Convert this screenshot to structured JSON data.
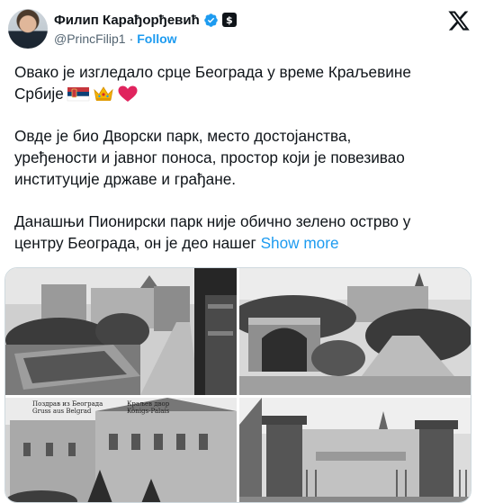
{
  "author": {
    "display_name": "Филип Карађорђевић",
    "handle": "@PrincFilip1",
    "separator": "·",
    "follow_label": "Follow",
    "badge_label": "$"
  },
  "tweet": {
    "line1": "Овако је изгледало срце Београда у време Краљевине",
    "line2": "Србије",
    "para2": "Овде је био Дворски парк, место достојанства, уређености и јавног поноса, простор који је повезивао институције државе и грађане.",
    "para3": "Данашњи Пионирски парк није обично зелено острво у центру Београда, он је део нашег",
    "show_more": "Show more"
  },
  "media": {
    "photo3_caption": "Поздрав из Београда\nGruss aus Belgrad",
    "photo3_caption2": "Краљев двор\nKönigs-Palais"
  },
  "colors": {
    "accent": "#1d9bf0",
    "text": "#0f1419",
    "secondary": "#536471"
  },
  "icons": [
    "verified-icon",
    "x-logo-icon",
    "serbian-flag-emoji",
    "crown-emoji",
    "red-heart-emoji"
  ]
}
